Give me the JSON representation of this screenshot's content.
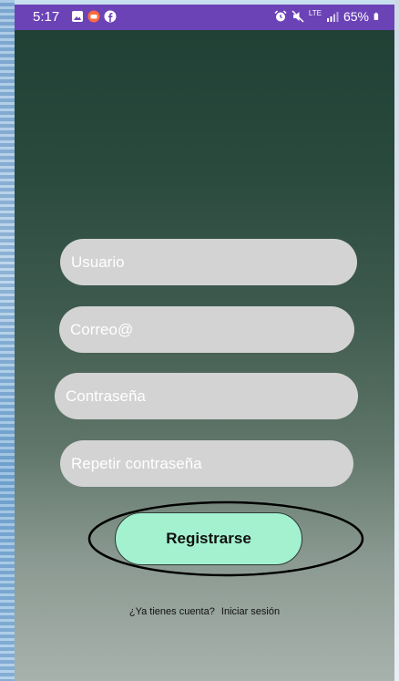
{
  "status_bar": {
    "time": "5:17",
    "network": "LTE",
    "battery": "65%",
    "color": "#6b43b6"
  },
  "form": {
    "username_placeholder": "Usuario",
    "email_placeholder": "Correo@",
    "password_placeholder": "Contraseña",
    "repeat_password_placeholder": "Repetir contraseña",
    "field_color": "#d3d3d3"
  },
  "register_button": {
    "label": "Registrarse",
    "color": "#a4f1cf"
  },
  "login_prompt": {
    "question": "¿Ya tienes cuenta?",
    "link": "Iniciar sesión"
  },
  "icons": [
    "gallery-icon",
    "app-notification-icon",
    "facebook-icon",
    "alarm-icon",
    "mute-icon",
    "signal-icon",
    "battery-icon"
  ]
}
